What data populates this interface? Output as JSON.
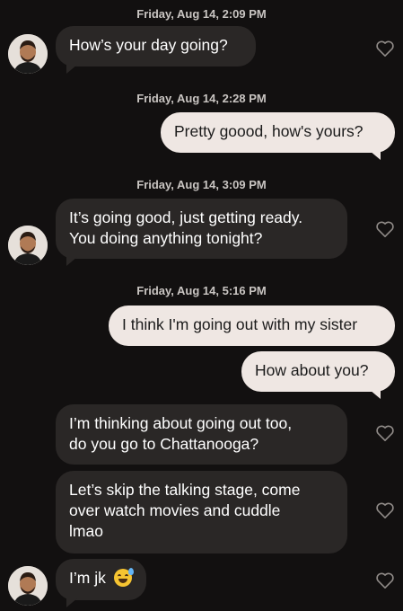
{
  "timestamps": {
    "t1": "Friday, Aug 14, 2:09 PM",
    "t2": "Friday, Aug 14, 2:28 PM",
    "t3": "Friday, Aug 14, 3:09 PM",
    "t4": "Friday, Aug 14, 5:16 PM"
  },
  "messages": {
    "m1": "How’s your day going?",
    "m2": "Pretty goood, how's yours?",
    "m3_line1": "It’s going good, just getting ready.",
    "m3_line2": "You doing anything tonight?",
    "m4": "I think I'm going out with my sister",
    "m5": "How about you?",
    "m6_line1": "I’m thinking about going out too,",
    "m6_line2": "do you go to Chattanooga?",
    "m7_line1": "Let’s skip the talking stage, come",
    "m7_line2": "over watch movies and cuddle",
    "m7_line3": "lmao",
    "m8": "I’m jk"
  },
  "icons": {
    "like": "heart-outline-icon",
    "emoji": "grinning-face-with-sweat"
  },
  "colors": {
    "background": "#121010",
    "incoming_bubble": "#2a2726",
    "outgoing_bubble": "#efe7e3"
  }
}
